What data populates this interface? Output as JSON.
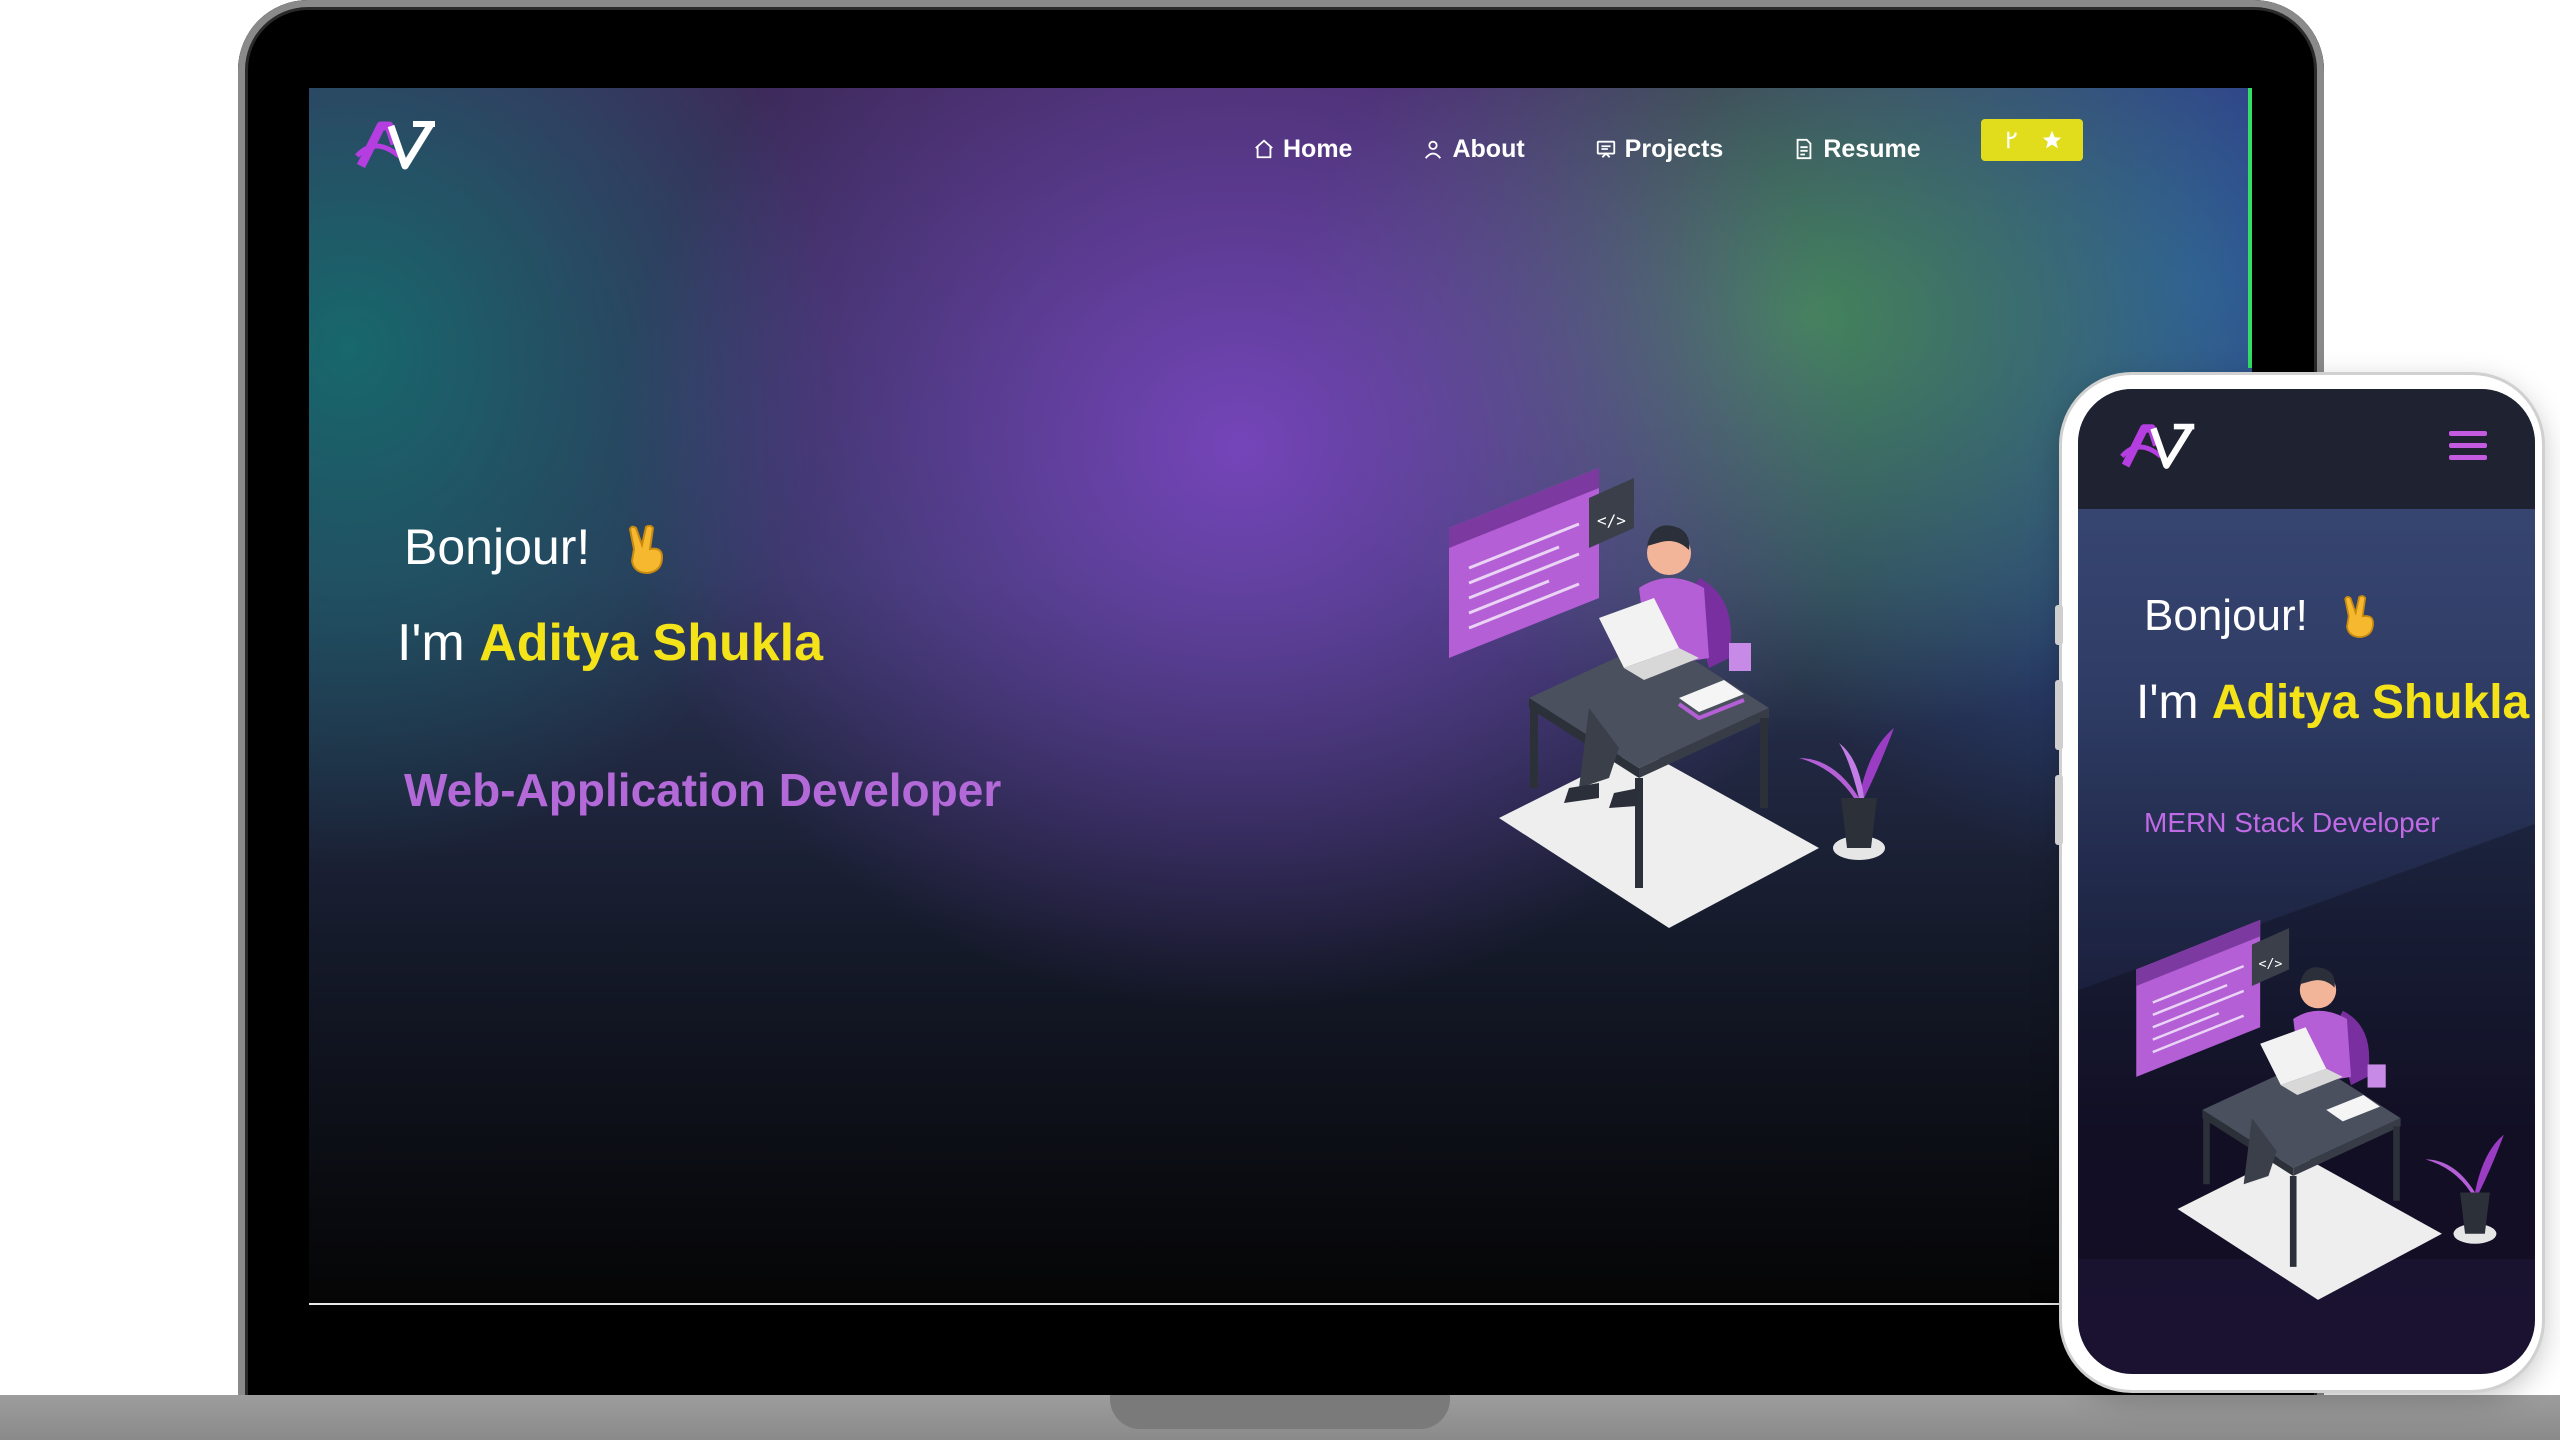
{
  "desktop": {
    "nav": {
      "items": [
        {
          "label": "Home",
          "icon": "home-icon"
        },
        {
          "label": "About",
          "icon": "user-icon"
        },
        {
          "label": "Projects",
          "icon": "projects-icon"
        },
        {
          "label": "Resume",
          "icon": "document-icon"
        }
      ],
      "github_button": {
        "icons": [
          "git-fork-icon",
          "star-icon"
        ],
        "color": "#e2dd1c"
      }
    },
    "hero": {
      "greeting": "Bonjour!",
      "intro_prefix": "I'm",
      "name": "Aditya Shukla",
      "role": "Web-Application Developer"
    }
  },
  "mobile": {
    "hero": {
      "greeting": "Bonjour!",
      "intro_prefix": "I'm",
      "name": "Aditya Shukla",
      "role": "MERN Stack Developer"
    },
    "menu_icon": "hamburger-icon"
  },
  "colors": {
    "name_accent": "#f3e318",
    "role_accent": "#b36ad8",
    "logo_purple": "#b43ee0"
  }
}
